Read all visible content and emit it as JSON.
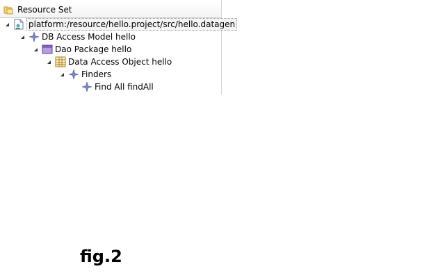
{
  "view": {
    "title": "Resource Set",
    "title_icon": "resource-set-icon"
  },
  "tree": {
    "root": {
      "label": "platform:/resource/hello.project/src/hello.datagen",
      "icon": "datagen-file-icon",
      "expanded": true,
      "selected": true
    },
    "db_access_model": {
      "label": "DB Access Model hello",
      "icon": "model-element-icon",
      "expanded": true
    },
    "dao_package": {
      "label": "Dao Package hello",
      "icon": "package-icon",
      "expanded": true
    },
    "data_access_object": {
      "label": "Data Access Object hello",
      "icon": "table-icon",
      "expanded": true
    },
    "finders": {
      "label": "Finders",
      "icon": "model-element-icon",
      "expanded": true
    },
    "find_all": {
      "label": "Find All findAll",
      "icon": "model-element-icon"
    }
  },
  "caption": {
    "text": "fig.2"
  }
}
